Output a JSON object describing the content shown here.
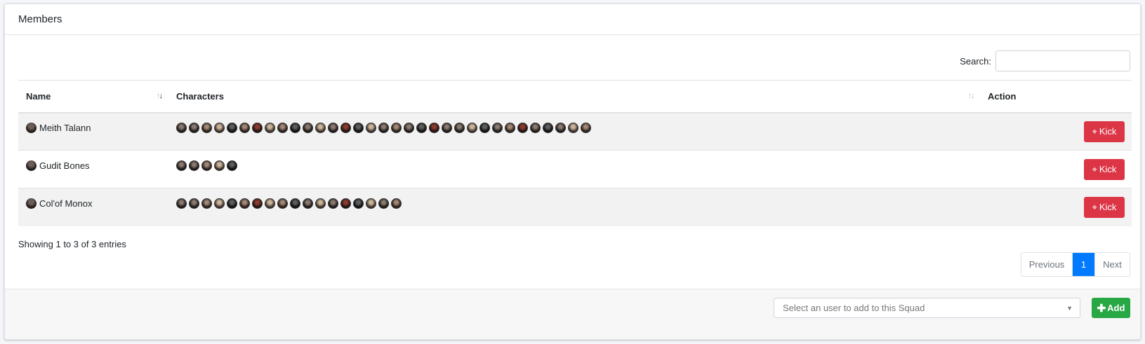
{
  "card": {
    "title": "Members"
  },
  "search": {
    "label": "Search:",
    "value": "",
    "placeholder": ""
  },
  "table": {
    "columns": [
      "Name",
      "Characters",
      "Action"
    ],
    "rows": [
      {
        "name": "Meith Talann",
        "character_count": 33,
        "action": "Kick"
      },
      {
        "name": "Gudit Bones",
        "character_count": 5,
        "action": "Kick"
      },
      {
        "name": "Col'of Monox",
        "character_count": 18,
        "action": "Kick"
      }
    ]
  },
  "info": "Showing 1 to 3 of 3 entries",
  "pagination": {
    "previous": "Previous",
    "current": "1",
    "next": "Next"
  },
  "footer": {
    "select_placeholder": "Select an user to add to this Squad",
    "add_label": "Add"
  },
  "colors": {
    "kick": "#dc3545",
    "add": "#28a745",
    "page_active": "#007bff"
  },
  "icons": {
    "kick": "crosshairs-icon",
    "add": "plus-icon",
    "select": "caret-down-icon"
  }
}
